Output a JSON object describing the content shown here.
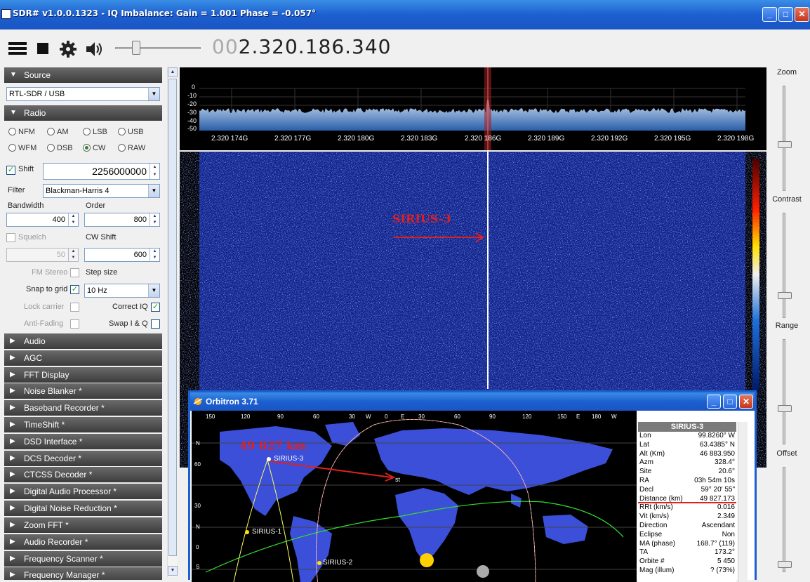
{
  "window": {
    "title": "SDR# v1.0.0.1323 - IQ Imbalance: Gain = 1.001 Phase = -0.057°"
  },
  "toolbar": {
    "frequency_dim": "00",
    "frequency": "2.320.186.340",
    "icons": [
      "menu-icon",
      "stop-icon",
      "gear-icon",
      "speaker-icon"
    ]
  },
  "sections": {
    "source": "Source",
    "radio": "Radio",
    "collapsed": [
      "Audio",
      "AGC",
      "FFT Display",
      "Noise Blanker *",
      "Baseband Recorder *",
      "TimeShift *",
      "DSD Interface *",
      "DCS Decoder *",
      "CTCSS Decoder *",
      "Digital Audio Processor *",
      "Digital Noise Reduction *",
      "Zoom FFT *",
      "Audio Recorder *",
      "Frequency Scanner *",
      "Frequency Manager *"
    ]
  },
  "source": {
    "device": "RTL-SDR / USB"
  },
  "radio": {
    "modes": [
      "NFM",
      "AM",
      "LSB",
      "USB",
      "WFM",
      "DSB",
      "CW",
      "RAW"
    ],
    "selected_mode": "CW",
    "shift_label": "Shift",
    "shift_value": "2256000000",
    "filter_label": "Filter",
    "filter_value": "Blackman-Harris 4",
    "bandwidth_label": "Bandwidth",
    "bandwidth_value": "400",
    "order_label": "Order",
    "order_value": "800",
    "squelch_label": "Squelch",
    "squelch_value": "50",
    "cwshift_label": "CW Shift",
    "cwshift_value": "600",
    "fmstereo_label": "FM Stereo",
    "stepsize_label": "Step size",
    "snap_label": "Snap to grid",
    "step_value": "10 Hz",
    "lockcarrier_label": "Lock carrier",
    "correctiq_label": "Correct IQ",
    "antifading_label": "Anti-Fading",
    "swapiq_label": "Swap I & Q"
  },
  "spectrum": {
    "db_labels": [
      "0",
      "-10",
      "-20",
      "-30",
      "-40",
      "-50"
    ],
    "freq_labels": [
      "2.320 174G",
      "2.320 177G",
      "2.320 180G",
      "2.320 183G",
      "2.320 186G",
      "2.320 189G",
      "2.320 192G",
      "2.320 195G",
      "2.320 198G"
    ]
  },
  "waterfall": {
    "annotation": "SIRIUS-3"
  },
  "right_panel": {
    "labels": [
      "Zoom",
      "Contrast",
      "Range",
      "Offset"
    ]
  },
  "orbitron": {
    "title": "Orbitron 3.71",
    "distance_annotation": "49 827 km",
    "longitude_labels": [
      "150",
      "120",
      "90",
      "60",
      "30",
      "W",
      "0",
      "E",
      "30",
      "60",
      "90",
      "120",
      "150",
      "E",
      "180",
      "W"
    ],
    "latitude_labels": [
      "N",
      "60",
      "30",
      "N",
      "0",
      "S"
    ],
    "satellites": [
      "SIRIUS-3",
      "SIRIUS-1",
      "SIRIUS-2"
    ],
    "observer": "st",
    "info_title": "SIRIUS-3",
    "info_rows": [
      {
        "k": "Lon",
        "v": "99.8260° W"
      },
      {
        "k": "Lat",
        "v": "63.4385° N"
      },
      {
        "k": "Alt (Km)",
        "v": "46 883.950"
      },
      {
        "k": "Azm",
        "v": "328.4°"
      },
      {
        "k": "Site",
        "v": "20.6°"
      },
      {
        "k": "RA",
        "v": "03h 54m 10s"
      },
      {
        "k": "Decl",
        "v": "59° 20' 55\""
      },
      {
        "k": "Distance (km)",
        "v": "49 827.173"
      },
      {
        "k": "RRt (km/s)",
        "v": "0.016"
      },
      {
        "k": "Vit (km/s)",
        "v": "2.349"
      },
      {
        "k": "Direction",
        "v": "Ascendant"
      },
      {
        "k": "Eclipse",
        "v": "Non"
      },
      {
        "k": "MA (phase)",
        "v": "168.7° (119)"
      },
      {
        "k": "TA",
        "v": "173.2°"
      },
      {
        "k": "Orbite #",
        "v": "5 450"
      },
      {
        "k": "Mag (illum)",
        "v": "? (73%)"
      }
    ]
  }
}
